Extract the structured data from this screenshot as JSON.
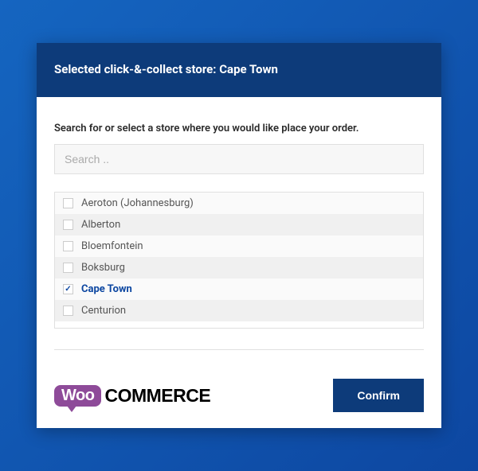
{
  "header": {
    "title": "Selected click-&-collect store: Cape Town"
  },
  "body": {
    "instructions": "Search for or select a store where you would like place your order.",
    "search_placeholder": "Search .."
  },
  "stores": [
    {
      "label": "Aeroton (Johannesburg)",
      "selected": false
    },
    {
      "label": "Alberton",
      "selected": false
    },
    {
      "label": "Bloemfontein",
      "selected": false
    },
    {
      "label": "Boksburg",
      "selected": false
    },
    {
      "label": "Cape Town",
      "selected": true
    },
    {
      "label": "Centurion",
      "selected": false
    }
  ],
  "brand": {
    "woo": "Woo",
    "commerce": "COMMERCE"
  },
  "footer": {
    "confirm_label": "Confirm"
  }
}
